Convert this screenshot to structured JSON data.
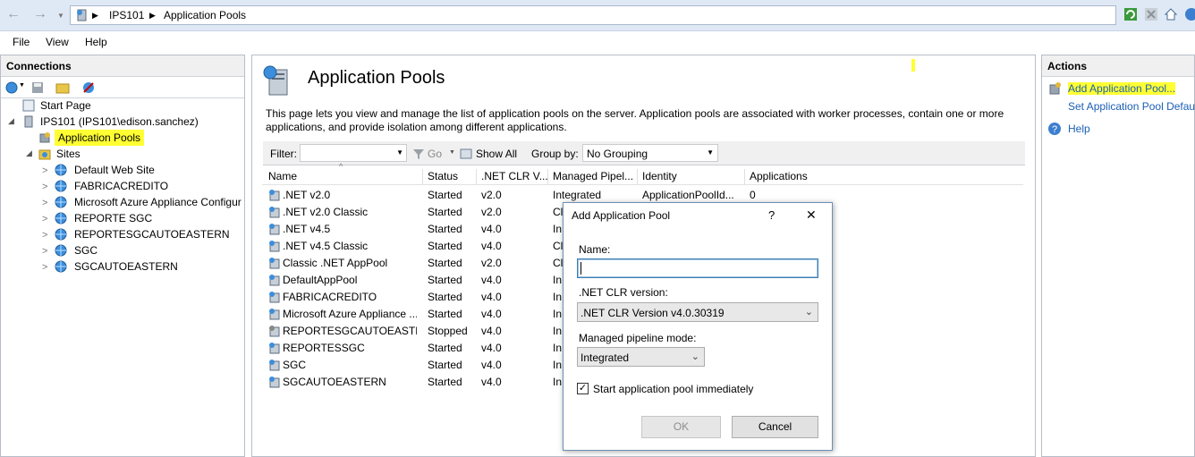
{
  "breadcrumb": {
    "server": "IPS101",
    "page": "Application Pools"
  },
  "menu": {
    "file": "File",
    "view": "View",
    "help": "Help"
  },
  "connections": {
    "title": "Connections",
    "start_page": "Start Page",
    "server_node": "IPS101 (IPS101\\edison.sanchez)",
    "app_pools": "Application Pools",
    "sites": "Sites",
    "site_list": [
      "Default Web Site",
      "FABRICACREDITO",
      "Microsoft Azure Appliance Configur",
      "REPORTE SGC",
      "REPORTESGCAUTOEASTERN",
      "SGC",
      "SGCAUTOEASTERN"
    ]
  },
  "main": {
    "title": "Application Pools",
    "description_line1": "This page lets you view and manage the list of application pools on the server. Application pools are associated with worker processes, contain one or more",
    "description_line2": "applications, and provide isolation among different applications.",
    "filter_label": "Filter:",
    "go_label": "Go",
    "show_all_label": "Show All",
    "group_by_label": "Group by:",
    "group_by_value": "No Grouping",
    "columns": [
      "Name",
      "Status",
      ".NET CLR V...",
      "Managed Pipel...",
      "Identity",
      "Applications"
    ],
    "first_row_extra": {
      "pipeline": "Integrated",
      "identity": "ApplicationPoolId...",
      "applications": "0"
    },
    "rows": [
      {
        "name": ".NET v2.0",
        "status": "Started",
        "clr": "v2.0",
        "pipe": "Integrated"
      },
      {
        "name": ".NET v2.0 Classic",
        "status": "Started",
        "clr": "v2.0",
        "pipe": "Cl"
      },
      {
        "name": ".NET v4.5",
        "status": "Started",
        "clr": "v4.0",
        "pipe": "In"
      },
      {
        "name": ".NET v4.5 Classic",
        "status": "Started",
        "clr": "v4.0",
        "pipe": "Cl"
      },
      {
        "name": "Classic .NET AppPool",
        "status": "Started",
        "clr": "v2.0",
        "pipe": "Cl"
      },
      {
        "name": "DefaultAppPool",
        "status": "Started",
        "clr": "v4.0",
        "pipe": "In"
      },
      {
        "name": "FABRICACREDITO",
        "status": "Started",
        "clr": "v4.0",
        "pipe": "In"
      },
      {
        "name": "Microsoft Azure Appliance ...",
        "status": "Started",
        "clr": "v4.0",
        "pipe": "In"
      },
      {
        "name": "REPORTESGCAUTOEASTERN",
        "status": "Stopped",
        "clr": "v4.0",
        "pipe": "In"
      },
      {
        "name": "REPORTESSGC",
        "status": "Started",
        "clr": "v4.0",
        "pipe": "In"
      },
      {
        "name": "SGC",
        "status": "Started",
        "clr": "v4.0",
        "pipe": "In"
      },
      {
        "name": "SGCAUTOEASTERN",
        "status": "Started",
        "clr": "v4.0",
        "pipe": "In"
      }
    ]
  },
  "actions": {
    "title": "Actions",
    "add_pool": "Add Application Pool...",
    "set_defaults": "Set Application Pool Defau",
    "help": "Help"
  },
  "dialog": {
    "title": "Add Application Pool",
    "help_glyph": "?",
    "close_glyph": "✕",
    "name_label": "Name:",
    "name_value": "",
    "clr_label": ".NET CLR version:",
    "clr_value": ".NET CLR Version v4.0.30319",
    "pipeline_label": "Managed pipeline mode:",
    "pipeline_value": "Integrated",
    "start_label": "Start application pool immediately",
    "start_checked": true,
    "ok_label": "OK",
    "cancel_label": "Cancel"
  },
  "colors": {
    "highlight": "#ffff33",
    "link": "#1b5fb5",
    "panel_header": "#f0f0f0"
  }
}
